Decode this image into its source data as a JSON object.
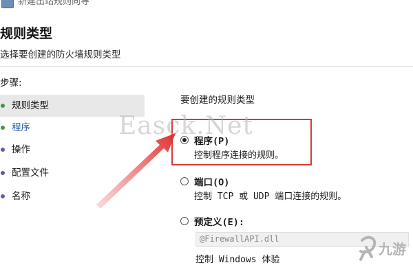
{
  "window": {
    "title": "新建出站规则向导"
  },
  "header": {
    "title": "规则类型",
    "subtitle": "选择要创建的防火墙规则类型"
  },
  "sidebar": {
    "heading": "步骤:",
    "steps": [
      {
        "label": "规则类型",
        "state": "current"
      },
      {
        "label": "程序",
        "state": "link"
      },
      {
        "label": "操作",
        "state": "plain"
      },
      {
        "label": "配置文件",
        "state": "plain"
      },
      {
        "label": "名称",
        "state": "plain"
      }
    ]
  },
  "main": {
    "section_label": "要创建的规则类型",
    "options": [
      {
        "title": "程序(P)",
        "desc": "控制程序连接的规则。",
        "checked": true
      },
      {
        "title": "端口(O)",
        "desc": "控制 TCP 或 UDP 端口连接的规则。",
        "checked": false
      },
      {
        "title": "预定义(E):",
        "desc": "控制 Windows 体验",
        "checked": false
      }
    ],
    "predefined_value": "@FirewallAPI.dll"
  },
  "overlay": {
    "watermark": "Easck.Net",
    "logo": "九游",
    "highlight_color": "#d9383a",
    "arrow_color": "#e04040"
  },
  "colors": {
    "selected_bg": "#e8e8e8",
    "link": "#2a5db0",
    "bullet_done": "#3c9a3c",
    "bullet_pending": "#6a55a8"
  }
}
